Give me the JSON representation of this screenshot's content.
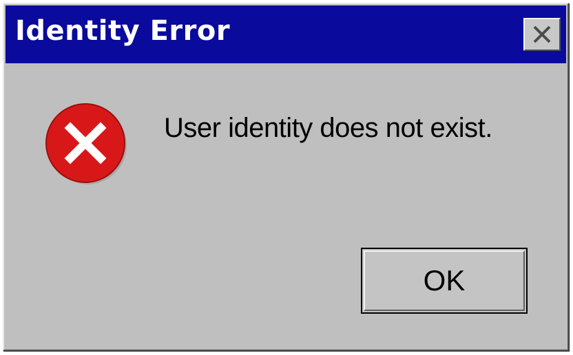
{
  "window": {
    "title": "Identity Error",
    "close_icon": "close-icon",
    "titlebar_color": "#0a0a9c",
    "body_color": "#bfbfbf"
  },
  "content": {
    "icon": "error-icon",
    "icon_color": "#d81818",
    "message": "User identity does not exist."
  },
  "buttons": {
    "ok_label": "OK"
  }
}
